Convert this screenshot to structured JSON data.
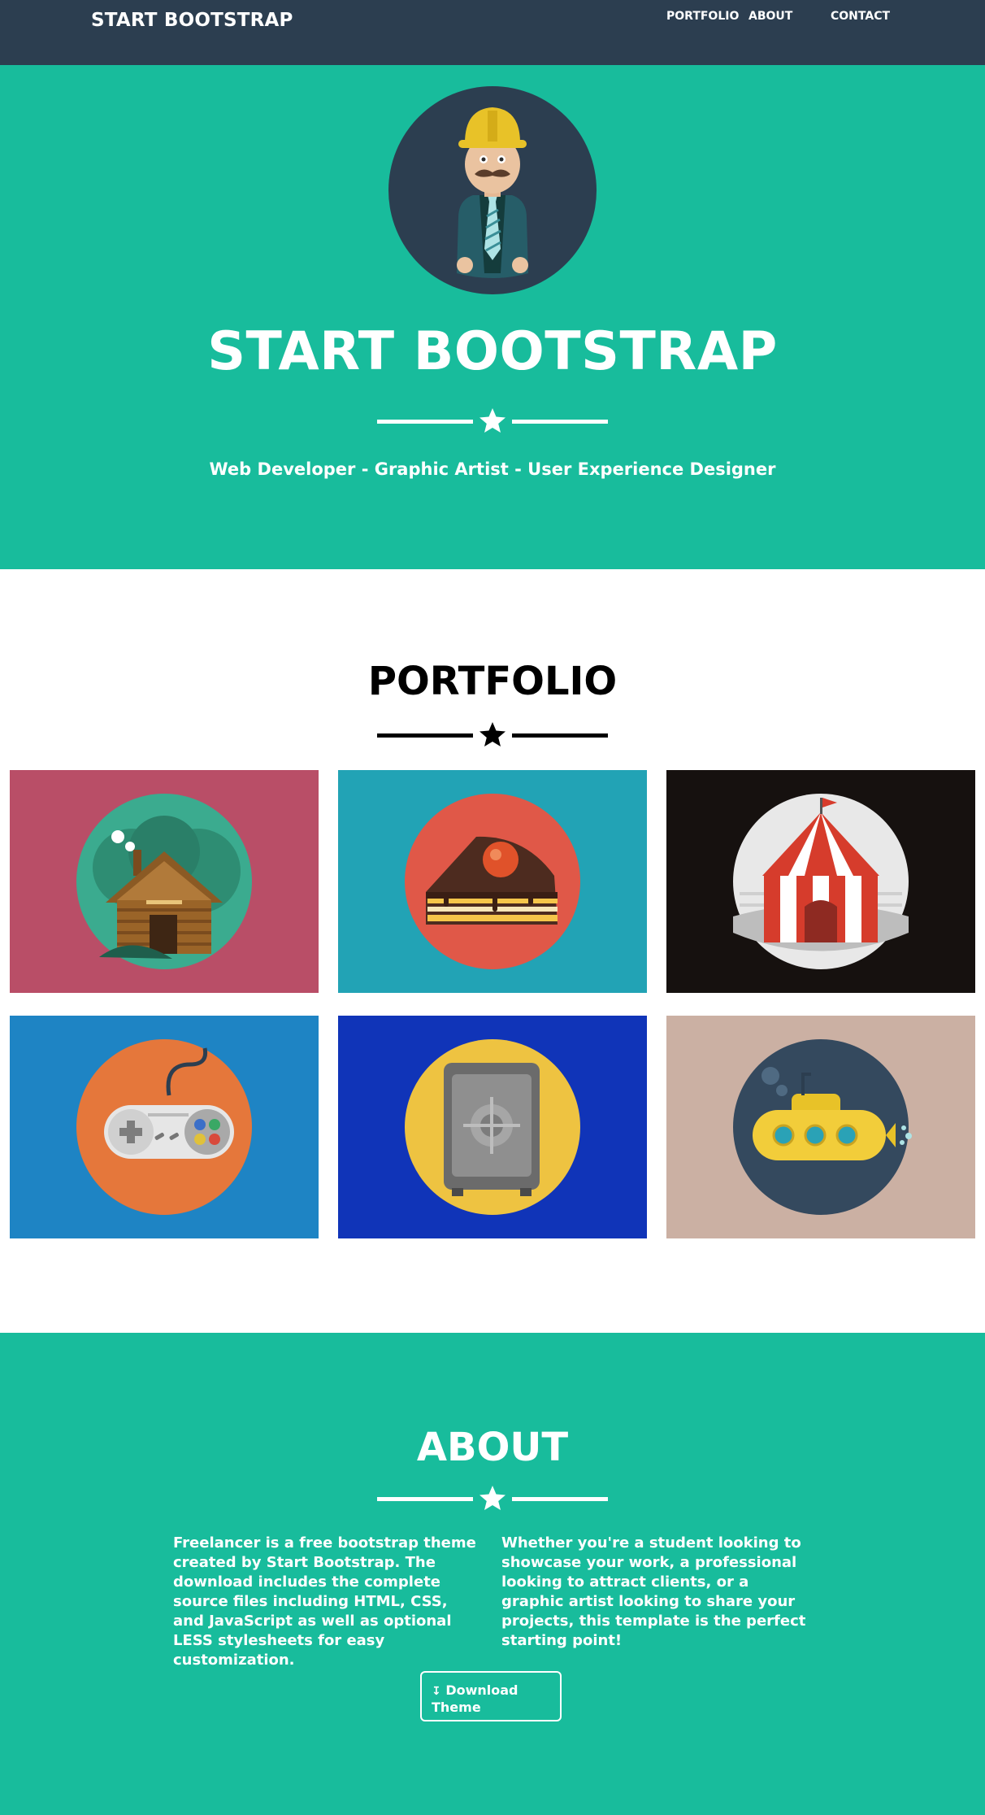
{
  "nav": {
    "brand": "START BOOTSTRAP",
    "links": [
      "PORTFOLIO",
      "ABOUT",
      "CONTACT"
    ]
  },
  "header": {
    "title": "START BOOTSTRAP",
    "subtitle": "Web Developer - Graphic Artist - User Experience Designer"
  },
  "portfolio": {
    "title": "PORTFOLIO",
    "items": [
      {
        "icon": "log-cabin-icon",
        "bg": "#b94e67",
        "circle": "#3bab8f"
      },
      {
        "icon": "cake-slice-icon",
        "bg": "#22a3b5",
        "circle": "#e05848"
      },
      {
        "icon": "circus-tent-icon",
        "bg": "#16110f",
        "circle": "#e8e8e8"
      },
      {
        "icon": "game-controller-icon",
        "bg": "#1e84c4",
        "circle": "#e5773b"
      },
      {
        "icon": "safe-icon",
        "bg": "#1034b8",
        "circle": "#eec341"
      },
      {
        "icon": "submarine-icon",
        "bg": "#cbb0a3",
        "circle": "#34495e"
      }
    ]
  },
  "about": {
    "title": "ABOUT",
    "col_left": "Freelancer is a free bootstrap theme created by Start Bootstrap. The download includes the complete source files including HTML, CSS, and JavaScript as well as optional LESS stylesheets for easy customization.",
    "col_right": "Whether you're a student looking to showcase your work, a professional looking to attract clients, or a graphic artist looking to share your projects, this template is the perfect starting point!",
    "button": "Download Theme"
  },
  "colors": {
    "primary": "#18bc9c",
    "navbar": "#2c3e50"
  }
}
